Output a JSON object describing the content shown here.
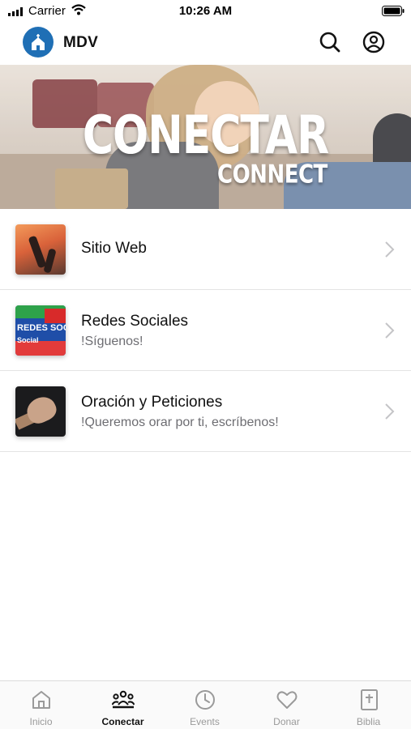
{
  "status_bar": {
    "carrier": "Carrier",
    "time": "10:26 AM"
  },
  "header": {
    "app_title": "MDV",
    "logo_color": "#1f6fb5",
    "icons": [
      "search-icon",
      "account-icon"
    ]
  },
  "hero": {
    "title": "CONECTAR",
    "subtitle": "CONNECT"
  },
  "list": {
    "items": [
      {
        "title": "Sitio Web",
        "subtitle": "",
        "thumb": "worship-hands-image"
      },
      {
        "title": "Redes Sociales",
        "subtitle": "!Síguenos!",
        "thumb": "social-media-collage-image"
      },
      {
        "title": "Oración y Peticiones",
        "subtitle": "!Queremos orar por ti, escríbenos!",
        "thumb": "praying-hand-image"
      }
    ]
  },
  "tabs": [
    {
      "label": "Inicio",
      "icon": "home-icon",
      "active": false
    },
    {
      "label": "Conectar",
      "icon": "people-icon",
      "active": true
    },
    {
      "label": "Events",
      "icon": "clock-icon",
      "active": false
    },
    {
      "label": "Donar",
      "icon": "heart-icon",
      "active": false
    },
    {
      "label": "Biblia",
      "icon": "bible-icon",
      "active": false
    }
  ],
  "colors": {
    "accent": "#1f6fb5",
    "tab_active": "#111111",
    "tab_inactive": "#9a9a9a",
    "subtitle_gray": "#6d6d72"
  }
}
